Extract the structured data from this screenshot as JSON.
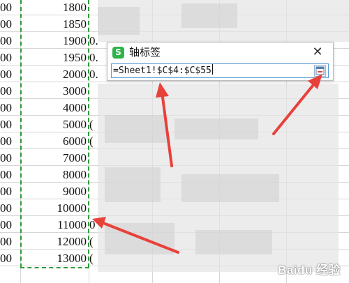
{
  "sheet": {
    "rows": [
      {
        "a": "00",
        "b": "1800",
        "c": ""
      },
      {
        "a": "00",
        "b": "1850",
        "c": ""
      },
      {
        "a": "00",
        "b": "1900",
        "c": "0."
      },
      {
        "a": "00",
        "b": "1950",
        "c": "0."
      },
      {
        "a": "00",
        "b": "2000",
        "c": "0."
      },
      {
        "a": "00",
        "b": "3000",
        "c": ""
      },
      {
        "a": "00",
        "b": "4000",
        "c": ""
      },
      {
        "a": "00",
        "b": "5000",
        "c": "("
      },
      {
        "a": "00",
        "b": "6000",
        "c": "("
      },
      {
        "a": "00",
        "b": "7000",
        "c": ""
      },
      {
        "a": "00",
        "b": "8000",
        "c": ""
      },
      {
        "a": "00",
        "b": "9000",
        "c": ""
      },
      {
        "a": "00",
        "b": "10000",
        "c": ""
      },
      {
        "a": "00",
        "b": "11000",
        "c": "0"
      },
      {
        "a": "00",
        "b": "12000",
        "c": "("
      },
      {
        "a": "00",
        "b": "13000",
        "c": "("
      }
    ]
  },
  "dialog": {
    "icon_letter": "S",
    "icon_name": "wps-spreadsheet-icon",
    "title": "轴标签",
    "close_symbol": "✕",
    "range_value": "=Sheet1!$C$4:$C$55"
  },
  "colors": {
    "selection_dash": "#2e9b3a",
    "arrow": "#e8413a",
    "input_border": "#5b9bd5",
    "app_icon": "#2db34a"
  },
  "watermark": "Baidu 经验"
}
